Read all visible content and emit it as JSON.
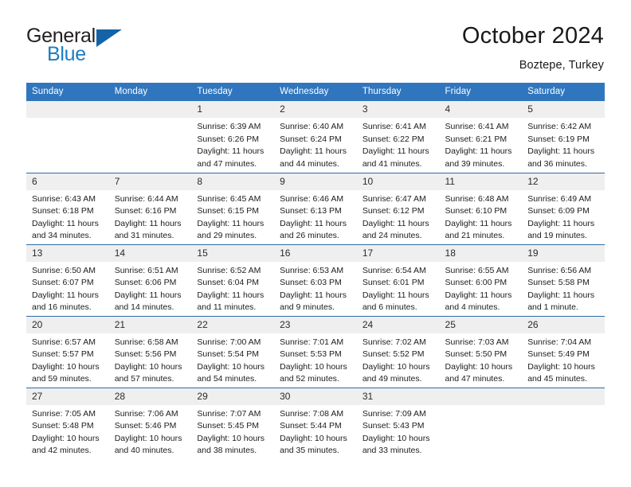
{
  "brand": {
    "word_one": "General",
    "word_two": "Blue",
    "logo_icon": "triangle-logo-icon"
  },
  "header": {
    "title": "October 2024",
    "subtitle": "Boztepe, Turkey"
  },
  "colors": {
    "header_blue": "#3076be",
    "row_divider_blue": "#2e6da4",
    "day_band_gray": "#efefef",
    "brand_blue": "#1b7dc4",
    "page_background": "#ffffff"
  },
  "weekdays": [
    "Sunday",
    "Monday",
    "Tuesday",
    "Wednesday",
    "Thursday",
    "Friday",
    "Saturday"
  ],
  "weeks": [
    [
      {
        "day": "",
        "empty": true
      },
      {
        "day": "",
        "empty": true
      },
      {
        "day": "1",
        "sunrise": "Sunrise: 6:39 AM",
        "sunset": "Sunset: 6:26 PM",
        "daylight_line1": "Daylight: 11 hours",
        "daylight_line2": "and 47 minutes."
      },
      {
        "day": "2",
        "sunrise": "Sunrise: 6:40 AM",
        "sunset": "Sunset: 6:24 PM",
        "daylight_line1": "Daylight: 11 hours",
        "daylight_line2": "and 44 minutes."
      },
      {
        "day": "3",
        "sunrise": "Sunrise: 6:41 AM",
        "sunset": "Sunset: 6:22 PM",
        "daylight_line1": "Daylight: 11 hours",
        "daylight_line2": "and 41 minutes."
      },
      {
        "day": "4",
        "sunrise": "Sunrise: 6:41 AM",
        "sunset": "Sunset: 6:21 PM",
        "daylight_line1": "Daylight: 11 hours",
        "daylight_line2": "and 39 minutes."
      },
      {
        "day": "5",
        "sunrise": "Sunrise: 6:42 AM",
        "sunset": "Sunset: 6:19 PM",
        "daylight_line1": "Daylight: 11 hours",
        "daylight_line2": "and 36 minutes."
      }
    ],
    [
      {
        "day": "6",
        "sunrise": "Sunrise: 6:43 AM",
        "sunset": "Sunset: 6:18 PM",
        "daylight_line1": "Daylight: 11 hours",
        "daylight_line2": "and 34 minutes."
      },
      {
        "day": "7",
        "sunrise": "Sunrise: 6:44 AM",
        "sunset": "Sunset: 6:16 PM",
        "daylight_line1": "Daylight: 11 hours",
        "daylight_line2": "and 31 minutes."
      },
      {
        "day": "8",
        "sunrise": "Sunrise: 6:45 AM",
        "sunset": "Sunset: 6:15 PM",
        "daylight_line1": "Daylight: 11 hours",
        "daylight_line2": "and 29 minutes."
      },
      {
        "day": "9",
        "sunrise": "Sunrise: 6:46 AM",
        "sunset": "Sunset: 6:13 PM",
        "daylight_line1": "Daylight: 11 hours",
        "daylight_line2": "and 26 minutes."
      },
      {
        "day": "10",
        "sunrise": "Sunrise: 6:47 AM",
        "sunset": "Sunset: 6:12 PM",
        "daylight_line1": "Daylight: 11 hours",
        "daylight_line2": "and 24 minutes."
      },
      {
        "day": "11",
        "sunrise": "Sunrise: 6:48 AM",
        "sunset": "Sunset: 6:10 PM",
        "daylight_line1": "Daylight: 11 hours",
        "daylight_line2": "and 21 minutes."
      },
      {
        "day": "12",
        "sunrise": "Sunrise: 6:49 AM",
        "sunset": "Sunset: 6:09 PM",
        "daylight_line1": "Daylight: 11 hours",
        "daylight_line2": "and 19 minutes."
      }
    ],
    [
      {
        "day": "13",
        "sunrise": "Sunrise: 6:50 AM",
        "sunset": "Sunset: 6:07 PM",
        "daylight_line1": "Daylight: 11 hours",
        "daylight_line2": "and 16 minutes."
      },
      {
        "day": "14",
        "sunrise": "Sunrise: 6:51 AM",
        "sunset": "Sunset: 6:06 PM",
        "daylight_line1": "Daylight: 11 hours",
        "daylight_line2": "and 14 minutes."
      },
      {
        "day": "15",
        "sunrise": "Sunrise: 6:52 AM",
        "sunset": "Sunset: 6:04 PM",
        "daylight_line1": "Daylight: 11 hours",
        "daylight_line2": "and 11 minutes."
      },
      {
        "day": "16",
        "sunrise": "Sunrise: 6:53 AM",
        "sunset": "Sunset: 6:03 PM",
        "daylight_line1": "Daylight: 11 hours",
        "daylight_line2": "and 9 minutes."
      },
      {
        "day": "17",
        "sunrise": "Sunrise: 6:54 AM",
        "sunset": "Sunset: 6:01 PM",
        "daylight_line1": "Daylight: 11 hours",
        "daylight_line2": "and 6 minutes."
      },
      {
        "day": "18",
        "sunrise": "Sunrise: 6:55 AM",
        "sunset": "Sunset: 6:00 PM",
        "daylight_line1": "Daylight: 11 hours",
        "daylight_line2": "and 4 minutes."
      },
      {
        "day": "19",
        "sunrise": "Sunrise: 6:56 AM",
        "sunset": "Sunset: 5:58 PM",
        "daylight_line1": "Daylight: 11 hours",
        "daylight_line2": "and 1 minute."
      }
    ],
    [
      {
        "day": "20",
        "sunrise": "Sunrise: 6:57 AM",
        "sunset": "Sunset: 5:57 PM",
        "daylight_line1": "Daylight: 10 hours",
        "daylight_line2": "and 59 minutes."
      },
      {
        "day": "21",
        "sunrise": "Sunrise: 6:58 AM",
        "sunset": "Sunset: 5:56 PM",
        "daylight_line1": "Daylight: 10 hours",
        "daylight_line2": "and 57 minutes."
      },
      {
        "day": "22",
        "sunrise": "Sunrise: 7:00 AM",
        "sunset": "Sunset: 5:54 PM",
        "daylight_line1": "Daylight: 10 hours",
        "daylight_line2": "and 54 minutes."
      },
      {
        "day": "23",
        "sunrise": "Sunrise: 7:01 AM",
        "sunset": "Sunset: 5:53 PM",
        "daylight_line1": "Daylight: 10 hours",
        "daylight_line2": "and 52 minutes."
      },
      {
        "day": "24",
        "sunrise": "Sunrise: 7:02 AM",
        "sunset": "Sunset: 5:52 PM",
        "daylight_line1": "Daylight: 10 hours",
        "daylight_line2": "and 49 minutes."
      },
      {
        "day": "25",
        "sunrise": "Sunrise: 7:03 AM",
        "sunset": "Sunset: 5:50 PM",
        "daylight_line1": "Daylight: 10 hours",
        "daylight_line2": "and 47 minutes."
      },
      {
        "day": "26",
        "sunrise": "Sunrise: 7:04 AM",
        "sunset": "Sunset: 5:49 PM",
        "daylight_line1": "Daylight: 10 hours",
        "daylight_line2": "and 45 minutes."
      }
    ],
    [
      {
        "day": "27",
        "sunrise": "Sunrise: 7:05 AM",
        "sunset": "Sunset: 5:48 PM",
        "daylight_line1": "Daylight: 10 hours",
        "daylight_line2": "and 42 minutes."
      },
      {
        "day": "28",
        "sunrise": "Sunrise: 7:06 AM",
        "sunset": "Sunset: 5:46 PM",
        "daylight_line1": "Daylight: 10 hours",
        "daylight_line2": "and 40 minutes."
      },
      {
        "day": "29",
        "sunrise": "Sunrise: 7:07 AM",
        "sunset": "Sunset: 5:45 PM",
        "daylight_line1": "Daylight: 10 hours",
        "daylight_line2": "and 38 minutes."
      },
      {
        "day": "30",
        "sunrise": "Sunrise: 7:08 AM",
        "sunset": "Sunset: 5:44 PM",
        "daylight_line1": "Daylight: 10 hours",
        "daylight_line2": "and 35 minutes."
      },
      {
        "day": "31",
        "sunrise": "Sunrise: 7:09 AM",
        "sunset": "Sunset: 5:43 PM",
        "daylight_line1": "Daylight: 10 hours",
        "daylight_line2": "and 33 minutes."
      },
      {
        "day": "",
        "empty": true
      },
      {
        "day": "",
        "empty": true
      }
    ]
  ]
}
